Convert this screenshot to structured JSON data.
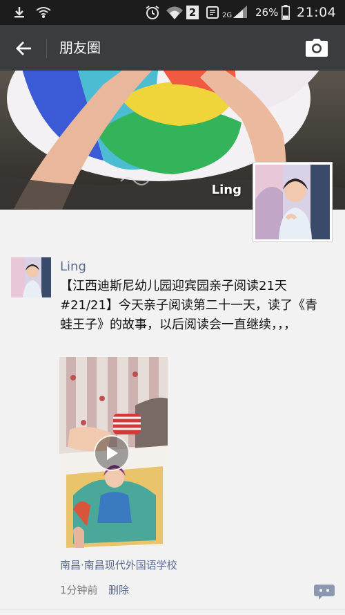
{
  "status_bar": {
    "battery_percent": "26%",
    "time": "21:04",
    "sim_badge": "2",
    "network_label": "2G",
    "icons": [
      "download-icon",
      "wifi-calling-icon",
      "alarm-icon",
      "wifi-icon",
      "sim2-icon",
      "sms-icon",
      "signal-icon",
      "battery-icon"
    ]
  },
  "header": {
    "title": "朋友圈",
    "back_icon": "arrow-left-icon",
    "camera_icon": "camera-icon"
  },
  "cover": {
    "username": "Ling"
  },
  "post": {
    "author": "Ling",
    "text": "【江西迪斯尼幼儿园迎宾园亲子阅读21天#21/21】今天亲子阅读第二十一天，读了《青蛙王子》的故事，以后阅读会一直继续，，，",
    "video_icon": "play-icon",
    "location": "南昌·南昌现代外国语学校",
    "time_ago": "1分钟前",
    "delete_label": "删除",
    "comment_icon": "comment-icon"
  },
  "colors": {
    "header_bg": "#3a3c40",
    "status_bg": "#1c1c1c",
    "link_blue": "#5b6a8f",
    "page_bg": "#f2f2f2"
  }
}
